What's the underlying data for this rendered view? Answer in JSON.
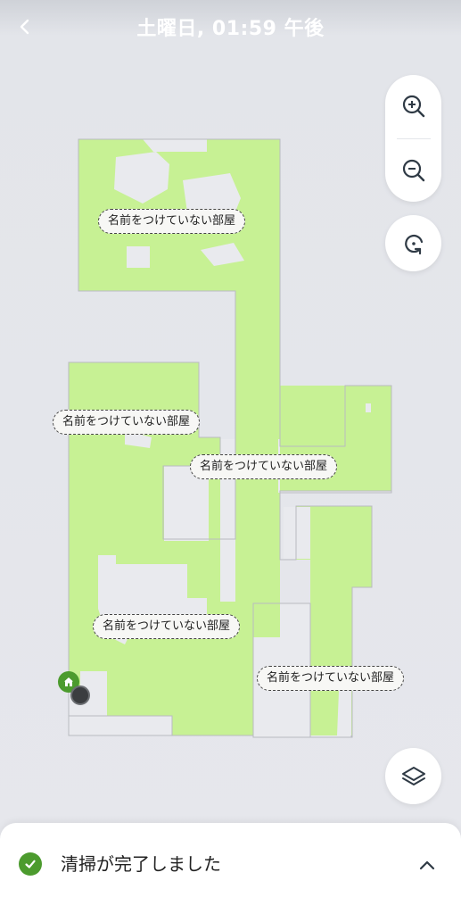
{
  "header": {
    "title": "土曜日, 01:59 午後",
    "back_icon": "chevron-left-icon"
  },
  "map": {
    "room_labels": [
      "名前をつけていない部屋",
      "名前をつけていない部屋",
      "名前をつけていない部屋",
      "名前をつけていない部屋",
      "名前をつけていない部屋"
    ],
    "colors": {
      "cleaned": "#c7f194",
      "uncleaned": "#e9eaee",
      "outline": "#b9bbc0",
      "dock": "#4c9b2e"
    }
  },
  "controls": {
    "zoom_in_icon": "zoom-in-icon",
    "zoom_out_icon": "zoom-out-icon",
    "rotate_icon": "rotate-icon",
    "layers_icon": "layers-icon"
  },
  "status": {
    "text": "清掃が完了しました",
    "icon": "check-circle-icon",
    "expand_icon": "chevron-up-icon"
  }
}
